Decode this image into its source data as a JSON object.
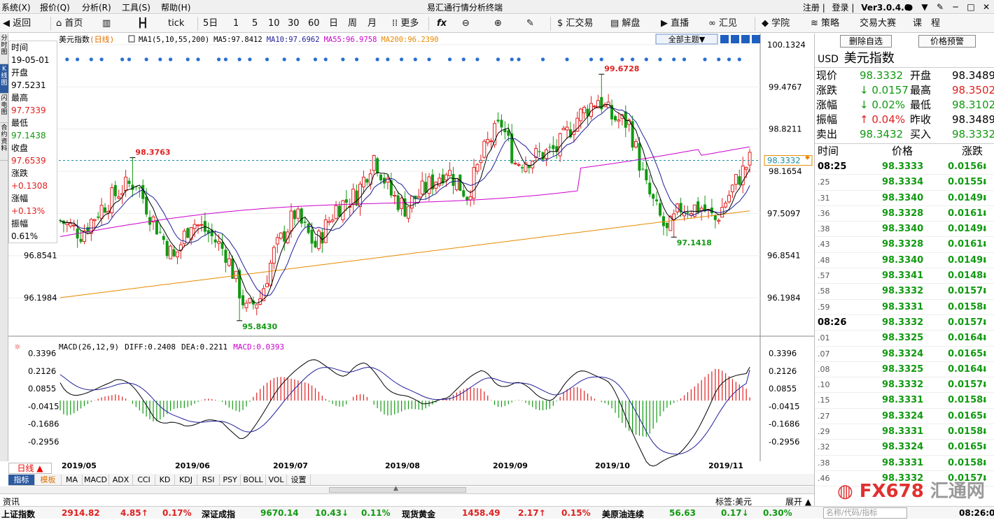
{
  "app": {
    "title": "易汇通行情分析终端",
    "version": "Ver3.0.4.6",
    "register": "注册",
    "login": "登录"
  },
  "menu": [
    "系统(X)",
    "报价(Q)",
    "分析(R)",
    "工具(S)",
    "帮助(H)"
  ],
  "toolbar": {
    "back": "返回",
    "home": "首页",
    "tick": "tick",
    "periods": [
      "5日",
      "1",
      "5",
      "10",
      "30",
      "60",
      "日",
      "周",
      "月"
    ],
    "more": "更多",
    "trade": "汇交易",
    "analysis": "解盘",
    "live": "直播",
    "huijian": "汇见",
    "school": "学院",
    "strategy": "策略",
    "contest": "交易大赛",
    "course": "课　程"
  },
  "leftstrip": [
    "分时图",
    "K线图",
    "闪电图",
    "合约资料"
  ],
  "chart": {
    "name": "美元指数",
    "period_tag": "(日线)",
    "ma_legend": {
      "ma1": "MA1(5,10,55,200)",
      "ma5": "MA5:97.8412",
      "ma10": "MA10:97.6962",
      "ma55": "MA55:96.9758",
      "ma200": "MA200:96.2390"
    },
    "theme_button": "全部主题▼",
    "price_axis": [
      "100.1324",
      "99.4767",
      "98.8211",
      "98.1654",
      "97.5097",
      "96.8541",
      "96.1984"
    ],
    "current_price_tag": "98.3332",
    "annotations": {
      "high": "99.6728",
      "low": "95.8430",
      "peak_may": "98.3763",
      "low_oct": "97.1418"
    },
    "macd_legend": {
      "name": "MACD(26,12,9)",
      "diff": "DIFF:0.2408",
      "dea": "DEA:0.2211",
      "macd": "MACD:0.0393"
    },
    "macd_axis": [
      "0.3396",
      "0.2126",
      "0.0855",
      "-0.0415",
      "-0.1686",
      "-0.2956"
    ],
    "x_labels": [
      "2019/05",
      "2019/06",
      "2019/07",
      "2019/08",
      "2019/09",
      "2019/10",
      "2019/11"
    ],
    "period_button": "日线 ▲",
    "colors": {
      "up": "#e02020",
      "down": "#119911",
      "ma5": "#000000",
      "ma10": "#1f1f99",
      "ma55": "#cc00cc",
      "ma200": "#e88a00"
    }
  },
  "infobox": [
    {
      "label": "时间",
      "value": "19-05-01",
      "cls": ""
    },
    {
      "label": "开盘",
      "value": "97.5231",
      "cls": ""
    },
    {
      "label": "最高",
      "value": "97.7339",
      "cls": "red"
    },
    {
      "label": "最低",
      "value": "97.1438",
      "cls": "green"
    },
    {
      "label": "收盘",
      "value": "97.6539",
      "cls": "red"
    },
    {
      "label": "涨跌",
      "value": "+0.1308",
      "cls": "red"
    },
    {
      "label": "涨幅",
      "value": "+0.13%",
      "cls": "red"
    },
    {
      "label": "振幅",
      "value": "0.61%",
      "cls": ""
    }
  ],
  "tabs": [
    "指标",
    "模板",
    "MA",
    "MACD",
    "ADX",
    "CCI",
    "KD",
    "KDJ",
    "RSI",
    "PSY",
    "BOLL",
    "VOL",
    "设置"
  ],
  "infobar": {
    "left": "资讯",
    "tag": "标签:美元",
    "expand": "展开 ▲"
  },
  "tickers": [
    {
      "name": "上证指数",
      "price": "2914.82",
      "chg": "4.85↑",
      "pct": "0.17%",
      "cls": "red"
    },
    {
      "name": "深证成指",
      "price": "9670.14",
      "chg": "10.43↓",
      "pct": "0.11%",
      "cls": "green"
    },
    {
      "name": "现货黄金",
      "price": "1458.49",
      "chg": "2.17↑",
      "pct": "0.15%",
      "cls": "red"
    },
    {
      "name": "美原油连续",
      "price": "56.63",
      "chg": "0.17↓",
      "pct": "0.30%",
      "cls": "green"
    }
  ],
  "clock": "08:26:03",
  "search_placeholder": "名称/代码/指标",
  "right": {
    "btn_remove": "删除自选",
    "btn_alert": "价格预警",
    "symbol": "USD",
    "name": "美元指数",
    "quote": [
      {
        "l1": "现价",
        "v1": "98.3332",
        "c1": "green",
        "l2": "开盘",
        "v2": "98.3489",
        "c2": ""
      },
      {
        "l1": "涨跌",
        "v1": "↓ 0.0157",
        "c1": "green",
        "l2": "最高",
        "v2": "98.3502",
        "c2": "red"
      },
      {
        "l1": "涨幅",
        "v1": "↓ 0.02%",
        "c1": "green",
        "l2": "最低",
        "v2": "98.3102",
        "c2": "green"
      },
      {
        "l1": "振幅",
        "v1": "↑ 0.04%",
        "c1": "red",
        "l2": "昨收",
        "v2": "98.3489",
        "c2": ""
      },
      {
        "l1": "卖出",
        "v1": "98.3432",
        "c1": "green",
        "l2": "买入",
        "v2": "98.3332",
        "c2": "green"
      }
    ],
    "tick_headers": [
      "时间",
      "价格",
      "涨跌"
    ],
    "ticks": [
      {
        "t": "08:25",
        "p": "98.3333",
        "c": "0.0156"
      },
      {
        "t": ".25",
        "p": "98.3334",
        "c": "0.0155"
      },
      {
        "t": ".31",
        "p": "98.3340",
        "c": "0.0149"
      },
      {
        "t": ".36",
        "p": "98.3328",
        "c": "0.0161"
      },
      {
        "t": ".38",
        "p": "98.3340",
        "c": "0.0149"
      },
      {
        "t": ".43",
        "p": "98.3328",
        "c": "0.0161"
      },
      {
        "t": ".48",
        "p": "98.3340",
        "c": "0.0149"
      },
      {
        "t": ".57",
        "p": "98.3341",
        "c": "0.0148"
      },
      {
        "t": ".58",
        "p": "98.3332",
        "c": "0.0157"
      },
      {
        "t": ".59",
        "p": "98.3331",
        "c": "0.0158"
      },
      {
        "t": "08:26",
        "p": "98.3332",
        "c": "0.0157"
      },
      {
        "t": ".01",
        "p": "98.3325",
        "c": "0.0164"
      },
      {
        "t": ".07",
        "p": "98.3324",
        "c": "0.0165"
      },
      {
        "t": ".08",
        "p": "98.3325",
        "c": "0.0164"
      },
      {
        "t": ".10",
        "p": "98.3332",
        "c": "0.0157"
      },
      {
        "t": ".15",
        "p": "98.3331",
        "c": "0.0158"
      },
      {
        "t": ".27",
        "p": "98.3324",
        "c": "0.0165"
      },
      {
        "t": ".29",
        "p": "98.3331",
        "c": "0.0158"
      },
      {
        "t": ".32",
        "p": "98.3324",
        "c": "0.0165"
      },
      {
        "t": ".38",
        "p": "98.3331",
        "c": "0.0158"
      },
      {
        "t": ".46",
        "p": "98.3332",
        "c": "0.0157"
      }
    ]
  },
  "watermark": {
    "a": "FX678",
    "b": "汇通网"
  }
}
